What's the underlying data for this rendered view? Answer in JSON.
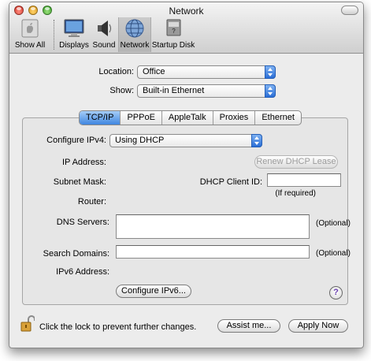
{
  "window": {
    "title": "Network"
  },
  "toolbar": {
    "items": [
      {
        "label": "Show All",
        "icon": "apple-icon"
      },
      {
        "label": "Displays",
        "icon": "display-icon"
      },
      {
        "label": "Sound",
        "icon": "speaker-icon"
      },
      {
        "label": "Network",
        "icon": "globe-icon",
        "selected": true
      },
      {
        "label": "Startup Disk",
        "icon": "disk-icon"
      }
    ]
  },
  "location": {
    "label": "Location:",
    "value": "Office"
  },
  "show": {
    "label": "Show:",
    "value": "Built-in Ethernet"
  },
  "tabs": [
    {
      "label": "TCP/IP",
      "active": true
    },
    {
      "label": "PPPoE"
    },
    {
      "label": "AppleTalk"
    },
    {
      "label": "Proxies"
    },
    {
      "label": "Ethernet"
    }
  ],
  "tcpip": {
    "configure_label": "Configure IPv4:",
    "configure_value": "Using DHCP",
    "ip_label": "IP Address:",
    "renew_button": "Renew DHCP Lease",
    "subnet_label": "Subnet Mask:",
    "client_id_label": "DHCP Client ID:",
    "client_id_value": "",
    "if_required": "(If required)",
    "router_label": "Router:",
    "dns_label": "DNS Servers:",
    "dns_value": "",
    "optional": "(Optional)",
    "search_label": "Search Domains:",
    "search_value": "",
    "ipv6_label": "IPv6 Address:",
    "configure_ipv6_button": "Configure IPv6...",
    "help_glyph": "?"
  },
  "footer": {
    "lock_text": "Click the lock to prevent further changes.",
    "assist_button": "Assist me...",
    "apply_button": "Apply Now"
  },
  "colors": {
    "accent": "#3f86e0",
    "help": "#6a3fb0"
  }
}
